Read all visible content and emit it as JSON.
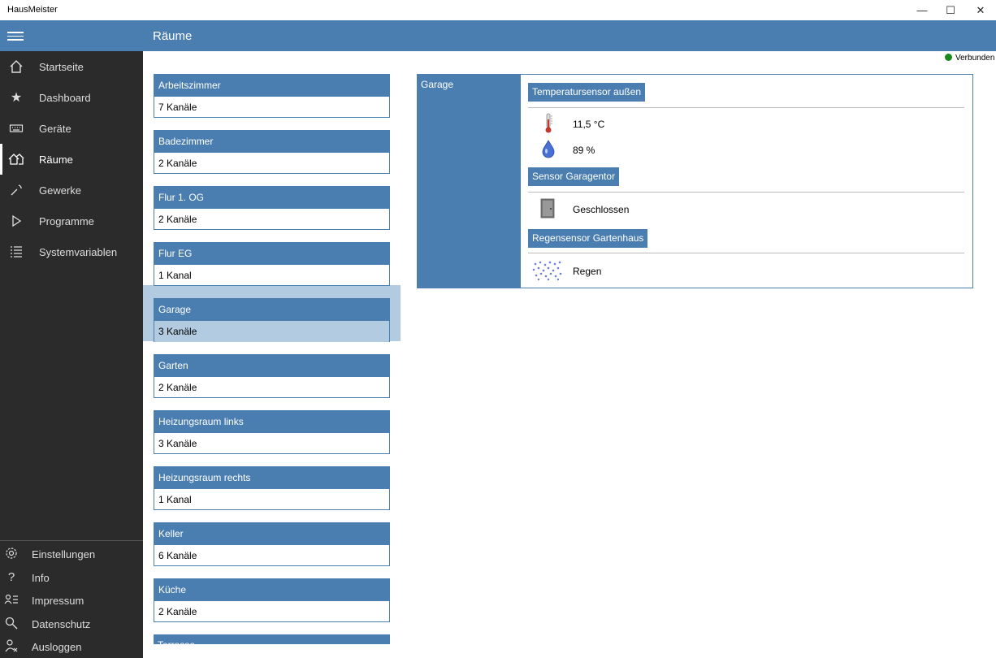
{
  "app": {
    "title": "HausMeister"
  },
  "window_buttons": {
    "minimize": "—",
    "maximize": "☐",
    "close": "✕"
  },
  "header": {
    "title": "Räume"
  },
  "status": {
    "label": "Verbunden",
    "color": "#1a8a1a"
  },
  "sidebar": {
    "items": [
      {
        "label": "Startseite",
        "icon": "home-icon"
      },
      {
        "label": "Dashboard",
        "icon": "star-icon"
      },
      {
        "label": "Geräte",
        "icon": "keyboard-icon"
      },
      {
        "label": "Räume",
        "icon": "rooms-icon",
        "active": true
      },
      {
        "label": "Gewerke",
        "icon": "wrench-icon"
      },
      {
        "label": "Programme",
        "icon": "play-icon"
      },
      {
        "label": "Systemvariablen",
        "icon": "list-icon"
      }
    ],
    "bottom": [
      {
        "label": "Einstellungen",
        "icon": "gear-icon"
      },
      {
        "label": "Info",
        "icon": "question-icon"
      },
      {
        "label": "Impressum",
        "icon": "contact-icon"
      },
      {
        "label": "Datenschutz",
        "icon": "search-key-icon"
      },
      {
        "label": "Ausloggen",
        "icon": "logout-icon"
      }
    ]
  },
  "rooms": [
    {
      "name": "Arbeitszimmer",
      "count": "7 Kanäle"
    },
    {
      "name": "Badezimmer",
      "count": "2 Kanäle"
    },
    {
      "name": "Flur 1. OG",
      "count": "2 Kanäle"
    },
    {
      "name": "Flur EG",
      "count": "1 Kanal"
    },
    {
      "name": "Garage",
      "count": "3 Kanäle",
      "selected": true
    },
    {
      "name": "Garten",
      "count": "2 Kanäle"
    },
    {
      "name": "Heizungsraum links",
      "count": "3 Kanäle"
    },
    {
      "name": "Heizungsraum rechts",
      "count": "1 Kanal"
    },
    {
      "name": "Keller",
      "count": "6 Kanäle"
    },
    {
      "name": "Küche",
      "count": "2 Kanäle"
    },
    {
      "name": "Terrasse",
      "count": ""
    }
  ],
  "detail": {
    "room": "Garage",
    "devices": [
      {
        "name": "Temperatursensor außen",
        "values": [
          {
            "icon": "thermometer-icon",
            "text": "11,5 °C"
          },
          {
            "icon": "humidity-drop-icon",
            "text": "89 %"
          }
        ]
      },
      {
        "name": "Sensor Garagentor",
        "values": [
          {
            "icon": "door-icon",
            "text": "Geschlossen"
          }
        ]
      },
      {
        "name": "Regensensor Gartenhaus",
        "values": [
          {
            "icon": "rain-icon",
            "text": "Regen"
          }
        ]
      }
    ]
  },
  "colors": {
    "accent": "#4a7eb0",
    "sidebar": "#2b2b2b",
    "selection": "#b3cbe0"
  }
}
